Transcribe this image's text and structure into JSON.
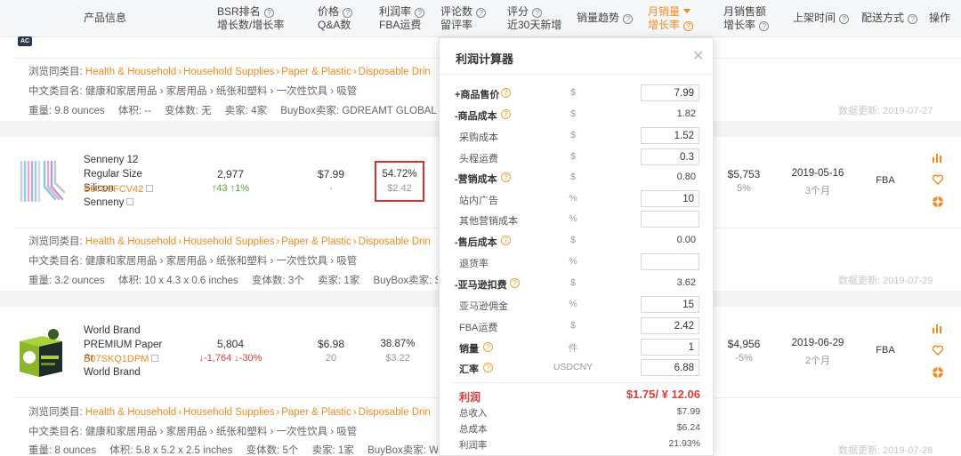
{
  "header": {
    "product_info": "产品信息",
    "bsr_l1": "BSR排名",
    "bsr_l2": "增长数/增长率",
    "price_l1": "价格",
    "price_l2": "Q&A数",
    "margin_l1": "利润率",
    "margin_l2": "FBA运费",
    "reviews_l1": "评论数",
    "reviews_l2": "留评率",
    "rating_l1": "评分",
    "rating_l2": "近30天新增",
    "sales_trend": "销量趋势",
    "monthly_sales_l1": "月销量",
    "monthly_sales_l2": "增长率",
    "monthly_revenue_l1": "月销售额",
    "monthly_revenue_l2": "增长率",
    "listing_date": "上架时间",
    "fulfillment": "配送方式",
    "actions": "操作",
    "sorted_color": "#f28a1f"
  },
  "badge": "AC",
  "labels": {
    "browse_category": "浏览同类目:",
    "cn_category": "中文类目名:",
    "weight": "重量:",
    "volume": "体积:",
    "variants": "变体数:",
    "sellers": "卖家:",
    "buybox": "BuyBox卖家:",
    "data_updated": "数据更新:"
  },
  "category_path": [
    "Health & Household",
    "Household Supplies",
    "Paper & Plastic",
    "Disposable Drin"
  ],
  "cn_path": "健康和家居用品 › 家居用品 › 纸张和塑料 › 一次性饮具 › 吸管",
  "rows": [
    {
      "weight": "9.8 ounces",
      "volume": "--",
      "variants": "无",
      "sellers": "4家",
      "buybox": "GDREAMT GLOBAL (F",
      "updated": "2019-07-27"
    },
    {
      "name": "Senneny 12 Regular Size Silicon",
      "asin": "B07S3FCV42",
      "brand": "Senneny",
      "bsr": "2,977",
      "bsr_change": "↑43",
      "bsr_rate": "↑1%",
      "price": "$7.99",
      "qa": "-",
      "margin": "54.72%",
      "fba_fee": "$2.42",
      "revenue": "$5,753",
      "revenue_growth": "5%",
      "listed": "2019-05-16",
      "listed_ago": "3个月",
      "fulfillment": "FBA",
      "weight": "3.2 ounces",
      "volume": "10 x 4.3 x 0.6 inches",
      "variants": "3个",
      "sellers": "1家",
      "buybox": "Se",
      "updated": "2019-07-29"
    },
    {
      "name": "World Brand PREMIUM Paper St",
      "asin": "B07SKQ1DPM",
      "brand": "World Brand",
      "bsr": "5,804",
      "bsr_change": "↓-1,764",
      "bsr_rate": "↓-30%",
      "price": "$6.98",
      "qa": "20",
      "margin": "38.87%",
      "fba_fee": "$3.22",
      "revenue": "$4,956",
      "revenue_growth": "-5%",
      "listed": "2019-06-29",
      "listed_ago": "2个月",
      "fulfillment": "FBA",
      "weight": "8 ounces",
      "volume": "5.8 x 5.2 x 2.5 inches",
      "variants": "5个",
      "sellers": "1家",
      "buybox": "Wo",
      "updated": "2019-07-28"
    }
  ],
  "calculator": {
    "title": "利润计算器",
    "close": "✕",
    "sale_price_label": "+商品售价",
    "sale_price_unit": "$",
    "sale_price": "7.99",
    "product_cost_label": "-商品成本",
    "product_cost_unit": "$",
    "product_cost": "1.82",
    "purchase_cost_label": "采购成本",
    "purchase_cost_unit": "$",
    "purchase_cost": "1.52",
    "freight_label": "头程运费",
    "freight_unit": "$",
    "freight": "0.3",
    "marketing_cost_label": "-营销成本",
    "marketing_cost_unit": "$",
    "marketing_cost": "0.80",
    "ppc_label": "站内广告",
    "ppc_unit": "%",
    "ppc": "10",
    "other_marketing_label": "其他营销成本",
    "other_marketing_unit": "%",
    "other_marketing": "",
    "after_sales_label": "-售后成本",
    "after_sales_unit": "$",
    "after_sales": "0.00",
    "return_rate_label": "退货率",
    "return_rate_unit": "%",
    "return_rate": "",
    "amazon_fee_label": "-亚马逊扣费",
    "amazon_fee_unit": "$",
    "amazon_fee": "3.62",
    "commission_label": "亚马逊佣金",
    "commission_unit": "%",
    "commission": "15",
    "fba_label": "FBA运费",
    "fba_unit": "$",
    "fba": "2.42",
    "sales_label": "销量",
    "sales_unit": "件",
    "sales": "1",
    "fx_label": "汇率",
    "fx_unit": "USDCNY",
    "fx": "6.88",
    "profit_label": "利润",
    "profit_value": "$1.75/ ¥ 12.06",
    "total_revenue_label": "总收入",
    "total_revenue": "$7.99",
    "total_cost_label": "总成本",
    "total_cost": "$6.24",
    "margin_label": "利润率",
    "margin": "21.93%"
  }
}
